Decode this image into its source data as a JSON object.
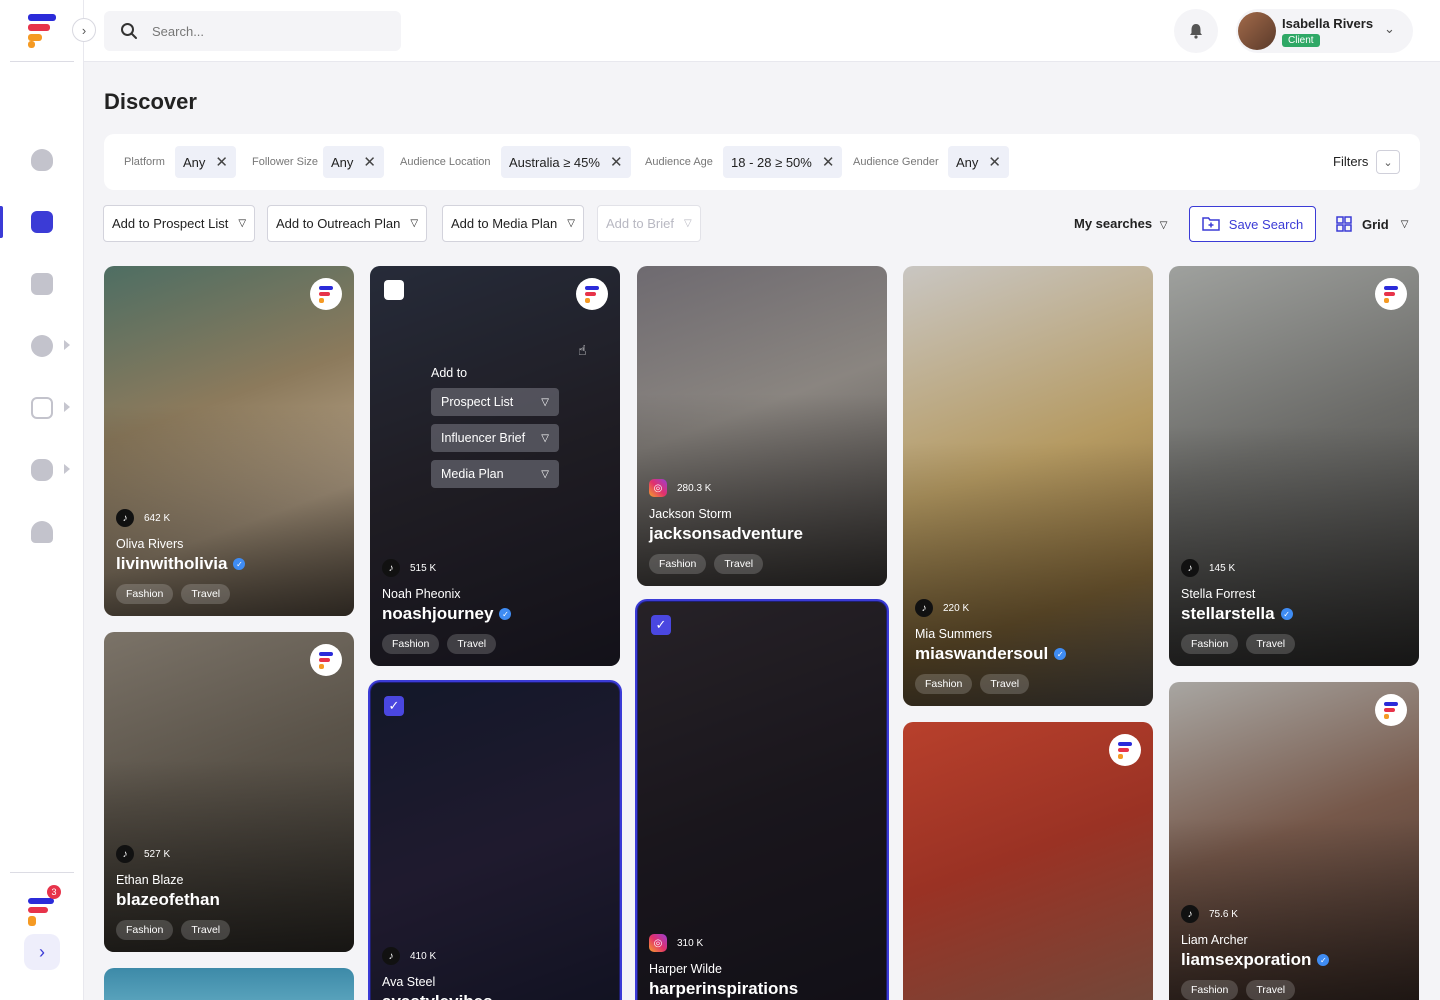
{
  "search": {
    "placeholder": "Search..."
  },
  "user": {
    "name": "Isabella Rivers",
    "role": "Client"
  },
  "sidebar": {
    "notification_count": "3"
  },
  "page": {
    "title": "Discover"
  },
  "filters": [
    {
      "label": "Platform",
      "value": "Any"
    },
    {
      "label": "Follower Size",
      "value": "Any"
    },
    {
      "label": "Audience Location",
      "value": "Australia ≥ 45%"
    },
    {
      "label": "Audience Age",
      "value": "18 - 28 ≥ 50%"
    },
    {
      "label": "Audience Gender",
      "value": "Any"
    }
  ],
  "filters_button": "Filters",
  "actions": {
    "prospect": "Add to Prospect List",
    "outreach": "Add to Outreach Plan",
    "media": "Add to Media Plan",
    "brief": "Add to Brief",
    "my_searches": "My searches",
    "save_search": "Save Search",
    "view": "Grid"
  },
  "hover_menu": {
    "title": "Add to",
    "options": [
      "Prospect List",
      "Influencer Brief",
      "Media Plan"
    ]
  },
  "tags": [
    "Fashion",
    "Travel"
  ],
  "creators": [
    {
      "followers": "642 K",
      "name": "Oliva Rivers",
      "handle": "livinwitholivia",
      "platform": "tiktok"
    },
    {
      "followers": "527 K",
      "name": "Ethan Blaze",
      "handle": "blazeofethan",
      "platform": "tiktok"
    },
    {
      "followers": "515 K",
      "name": "Noah Pheonix",
      "handle": "noashjourney",
      "platform": "tiktok"
    },
    {
      "followers": "410 K",
      "name": "Ava Steel",
      "handle": "avastylevibes",
      "platform": "tiktok"
    },
    {
      "followers": "280.3 K",
      "name": "Jackson Storm",
      "handle": "jacksonsadventure",
      "platform": "instagram"
    },
    {
      "followers": "310 K",
      "name": "Harper Wilde",
      "handle": "harperinspirations",
      "platform": "instagram"
    },
    {
      "followers": "220 K",
      "name": "Mia Summers",
      "handle": "miaswandersoul",
      "platform": "tiktok"
    },
    {
      "followers": "145 K",
      "name": "Stella Forrest",
      "handle": "stellarstella",
      "platform": "tiktok"
    },
    {
      "followers": "75.6 K",
      "name": "Liam Archer",
      "handle": "liamsexporation",
      "platform": "tiktok"
    }
  ],
  "colors": {
    "accent": "#3b3bd6",
    "verified": "#3f8cf3",
    "client_badge": "#2fa866",
    "notification": "#e7334a"
  }
}
